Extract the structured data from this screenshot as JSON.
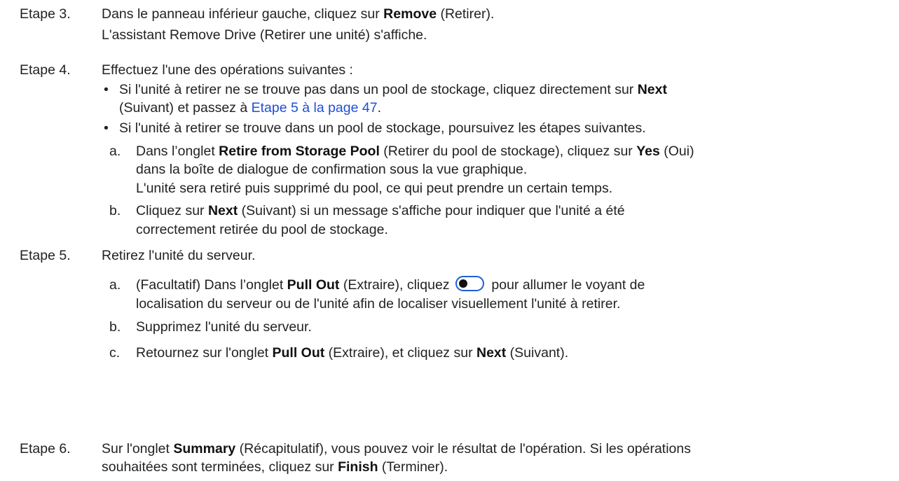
{
  "steps": [
    {
      "label": "Etape 3.",
      "lines": [
        [
          "Dans le panneau inférieur gauche, cliquez sur ",
          {
            "b": "Remove"
          },
          " (Retirer)."
        ],
        [
          "L'assistant Remove Drive (Retirer une unité) s'affiche."
        ]
      ]
    },
    {
      "label": "Etape 4.",
      "intro": "Effectuez l'une des opérations suivantes :",
      "bullets": [
        {
          "l1_pre": "Si l'unité à retirer ne se trouve pas dans un pool de stockage, cliquez directement sur ",
          "l1_bold": "Next",
          "l2_pre": "(Suivant) et passez à ",
          "l2_link": "Etape 5 à la page 47",
          "l2_post": "."
        },
        {
          "l1": "Si l'unité à retirer se trouve dans un pool de stockage, poursuivez les étapes suivantes."
        }
      ],
      "subs": [
        {
          "letter": "a.",
          "l1_pre": "Dans l’onglet ",
          "l1_bold1": "Retire from Storage Pool",
          "l1_mid": " (Retirer du pool de stockage), cliquez sur ",
          "l1_bold2": "Yes",
          "l1_post": " (Oui)",
          "l2": "dans la boîte de dialogue de confirmation sous la vue graphique.",
          "l3": "L'unité sera retiré puis supprimé du pool, ce qui peut prendre un certain temps."
        },
        {
          "letter": "b.",
          "l1_pre": "Cliquez sur ",
          "l1_bold": "Next",
          "l1_post": " (Suivant) si un message s'affiche pour indiquer que l'unité a été",
          "l2": "correctement retirée du pool de stockage."
        }
      ]
    },
    {
      "label": "Etape 5.",
      "intro": "Retirez l'unité du serveur.",
      "subs": [
        {
          "letter": "a.",
          "l1_pre": "(Facultatif) Dans l’onglet ",
          "l1_bold": "Pull Out",
          "l1_mid": " (Extraire), cliquez ",
          "l1_post": " pour allumer le voyant de",
          "l2": "localisation du serveur ou de l'unité afin de localiser visuellement l'unité à retirer.",
          "icon": "toggle-switch-icon"
        },
        {
          "letter": "b.",
          "l1": "Supprimez l'unité du serveur."
        },
        {
          "letter": "c.",
          "l1_pre": "Retournez sur l'onglet ",
          "l1_bold1": "Pull Out",
          "l1_mid": " (Extraire), et cliquez sur ",
          "l1_bold2": "Next",
          "l1_post": " (Suivant)."
        }
      ]
    },
    {
      "label": "Etape 6.",
      "l1_pre": "Sur l'onglet ",
      "l1_bold": "Summary",
      "l1_post": " (Récapitulatif), vous pouvez voir le résultat de l'opération. Si les opérations",
      "l2_pre": "souhaitées sont terminées, cliquez sur ",
      "l2_bold": "Finish",
      "l2_post": " (Terminer)."
    }
  ],
  "colors": {
    "link": "#1f4fd8",
    "icon": "#1d5fd6"
  }
}
